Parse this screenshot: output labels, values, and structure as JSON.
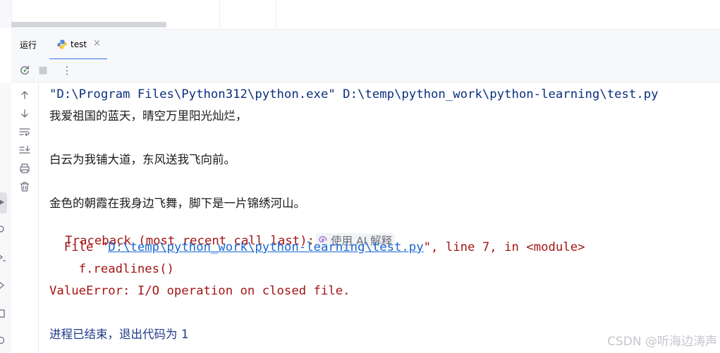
{
  "tool_window": {
    "title": "运行",
    "tab": {
      "label": "test",
      "close": "×",
      "icon": "python-icon"
    }
  },
  "toolbar": {
    "buttons": [
      "rerun-icon",
      "stop-icon",
      "more-options-icon"
    ],
    "more_glyph": "⋮"
  },
  "gutter": {
    "buttons": [
      "arrow-up-icon",
      "arrow-down-icon",
      "soft-wrap-icon",
      "scroll-to-end-icon",
      "print-icon",
      "trash-icon"
    ]
  },
  "console": {
    "command": "\"D:\\Program Files\\Python312\\python.exe\" D:\\temp\\python_work\\python-learning\\test.py",
    "out1": "我爱祖国的蓝天，晴空万里阳光灿烂，",
    "out2": "白云为我铺大道，东风送我飞向前。",
    "out3": "金色的朝霞在我身边飞舞，脚下是一片锦绣河山。",
    "traceback": "Traceback (most recent call last):",
    "ai_explain": "使用 AI 解释",
    "file_prefix": "  File \"",
    "file_path": "D:\\temp\\python_work\\python-learning\\test.py",
    "file_suffix": "\", line 7, in <module>",
    "code_line": "    f.readlines()",
    "error": "ValueError: I/O operation on closed file.",
    "exit_text": "进程已结束，退出代码为 ",
    "exit_code": "1"
  },
  "watermark": "CSDN @听海边涛声",
  "colors": {
    "accent": "#3574f0",
    "error": "#a31515",
    "command": "#0b2f7f",
    "link": "#1967d2"
  }
}
